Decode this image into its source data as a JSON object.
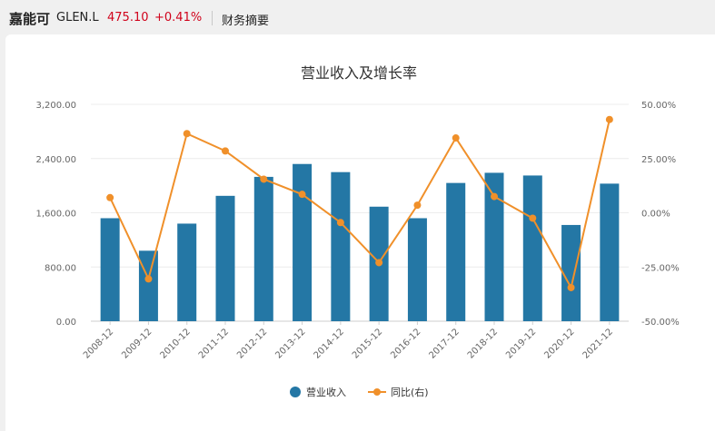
{
  "header": {
    "name": "嘉能可",
    "ticker": "GLEN.L",
    "price": "475.10",
    "change": "+0.41%",
    "section": "财务摘要"
  },
  "colors": {
    "bar": "#2477a5",
    "line": "#f0902a",
    "up": "#d0021b"
  },
  "chart_data": {
    "type": "bar",
    "title": "营业收入及增长率",
    "categories": [
      "2008-12",
      "2009-12",
      "2010-12",
      "2011-12",
      "2012-12",
      "2013-12",
      "2014-12",
      "2015-12",
      "2016-12",
      "2017-12",
      "2018-12",
      "2019-12",
      "2020-12",
      "2021-12"
    ],
    "series": [
      {
        "name": "营业收入",
        "type": "bar",
        "axis": "left",
        "values": [
          1520,
          1040,
          1440,
          1850,
          2130,
          2320,
          2200,
          1690,
          1520,
          2040,
          2190,
          2150,
          1420,
          2030
        ]
      },
      {
        "name": "同比(右)",
        "type": "line",
        "axis": "right",
        "values": [
          7.0,
          -30.5,
          36.5,
          28.5,
          15.5,
          8.5,
          -4.5,
          -23.0,
          3.5,
          34.5,
          7.5,
          -2.5,
          -34.5,
          43.0
        ]
      }
    ],
    "left_axis": {
      "ylim": [
        0,
        3200
      ],
      "ticks": [
        "0.00",
        "800.00",
        "1,600.00",
        "2,400.00",
        "3,200.00"
      ]
    },
    "right_axis": {
      "ylim": [
        -50,
        50
      ],
      "ticks": [
        "-50.00%",
        "-25.00%",
        "0.00%",
        "25.00%",
        "50.00%"
      ]
    },
    "grid": true,
    "legend_position": "bottom-center"
  }
}
